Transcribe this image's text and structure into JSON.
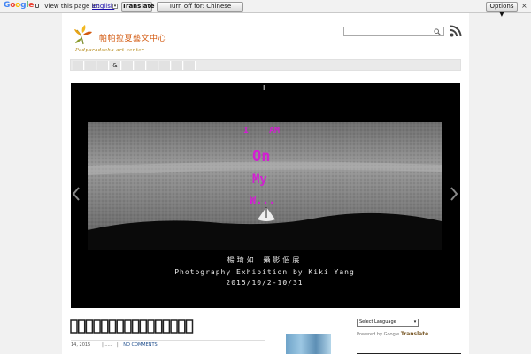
{
  "translate_bar": {
    "google_logo": "Google",
    "view_text": "View this page in:",
    "language": "English",
    "translate_button": "Translate",
    "turn_off_button": "Turn off for: Chinese",
    "options_button": "Options ▼",
    "close_symbol": "×"
  },
  "header": {
    "site_name_cn": "帕帕拉夏藝文中心",
    "site_name_en": "Padparadscha art center"
  },
  "nav": {
    "items": [
      "",
      "",
      "",
      "&",
      "",
      "",
      "",
      "",
      "",
      ""
    ]
  },
  "slider": {
    "pause_symbol": "II",
    "artwork_text": [
      "I",
      "AM",
      "On",
      "My",
      "W..."
    ],
    "artist_cn": "楊琦如  攝影個展",
    "exhibition_title": "Photography Exhibition by Kiki Yang",
    "dates": "2015/10/2-10/31"
  },
  "post": {
    "title": "□□□□□□□□□□□□□□□□",
    "date": "14, 2015",
    "sep1": "|",
    "author": "|......",
    "sep2": "|",
    "comments": "NO COMMENTS"
  },
  "sidebar": {
    "select_value": "Select Language",
    "powered_by": "Powered by",
    "google": "Google",
    "translate": "Translate"
  },
  "colors": {
    "brand_orange": "#d35a10",
    "artwork_magenta": "#d21fd2"
  }
}
